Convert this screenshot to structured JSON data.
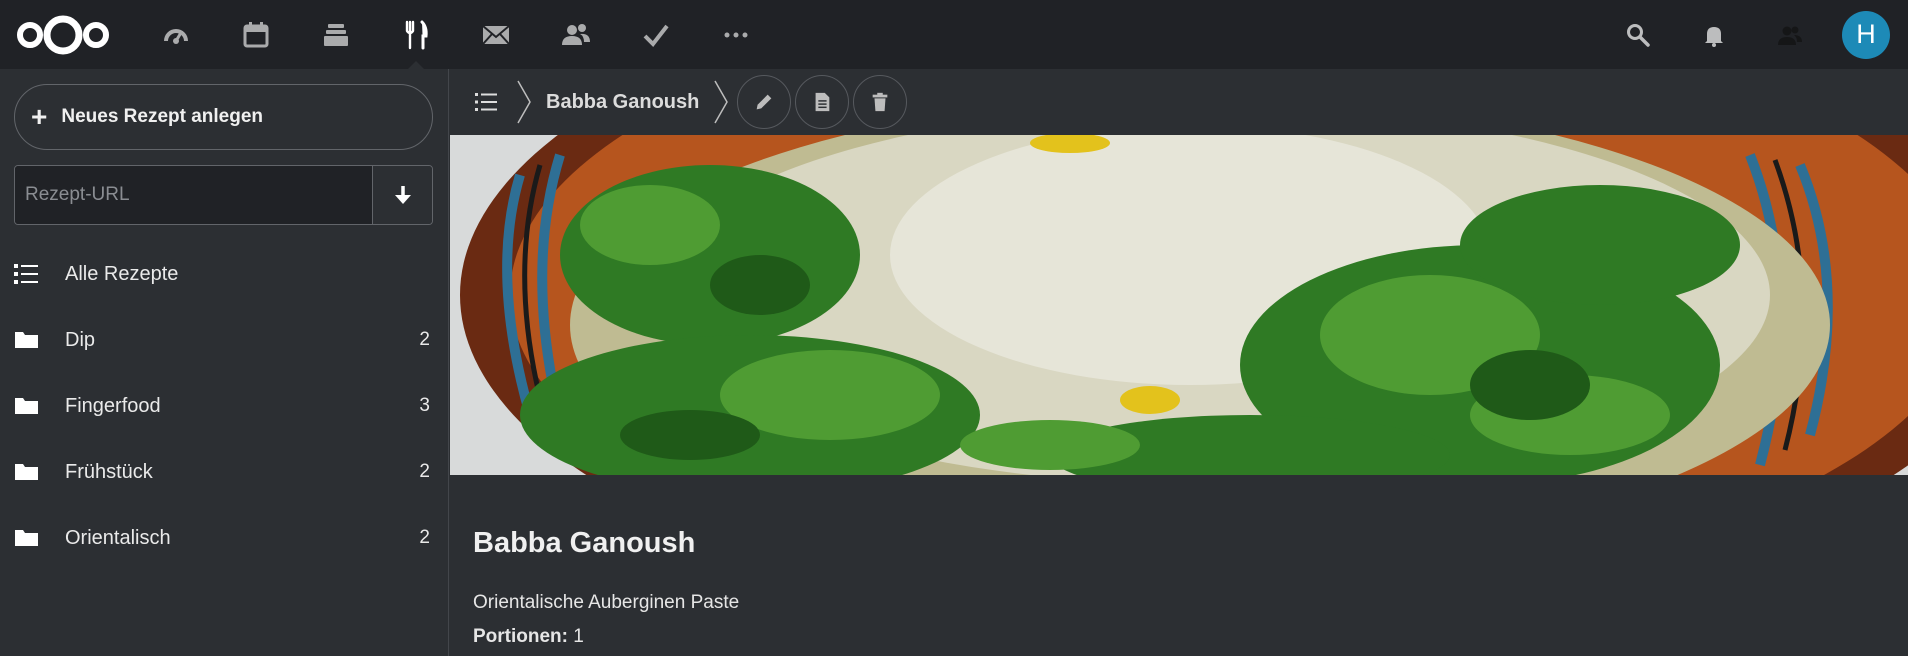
{
  "header": {
    "apps": [
      {
        "name": "dashboard-icon"
      },
      {
        "name": "calendar-icon"
      },
      {
        "name": "files-icon"
      },
      {
        "name": "cookbook-icon",
        "active": true
      },
      {
        "name": "mail-icon"
      },
      {
        "name": "contacts-icon"
      },
      {
        "name": "tasks-icon"
      },
      {
        "name": "more-icon"
      }
    ],
    "right": [
      "search-icon",
      "notifications-icon",
      "contacts-menu-icon"
    ],
    "avatar_initial": "H",
    "avatar_color": "#1d8ab7"
  },
  "sidebar": {
    "new_recipe_label": "Neues Rezept anlegen",
    "url_placeholder": "Rezept-URL",
    "items": [
      {
        "label": "Alle Rezepte",
        "icon": "list-icon",
        "count": ""
      },
      {
        "label": "Dip",
        "icon": "folder-icon",
        "count": "2"
      },
      {
        "label": "Fingerfood",
        "icon": "folder-icon",
        "count": "3"
      },
      {
        "label": "Frühstück",
        "icon": "folder-icon",
        "count": "2"
      },
      {
        "label": "Orientalisch",
        "icon": "folder-icon",
        "count": "2"
      }
    ]
  },
  "toolbar": {
    "breadcrumb_title": "Babba Ganoush"
  },
  "recipe": {
    "title": "Babba Ganoush",
    "description": "Orientalische Auberginen Paste",
    "yield_label": "Portionen:",
    "yield_value": "1"
  }
}
